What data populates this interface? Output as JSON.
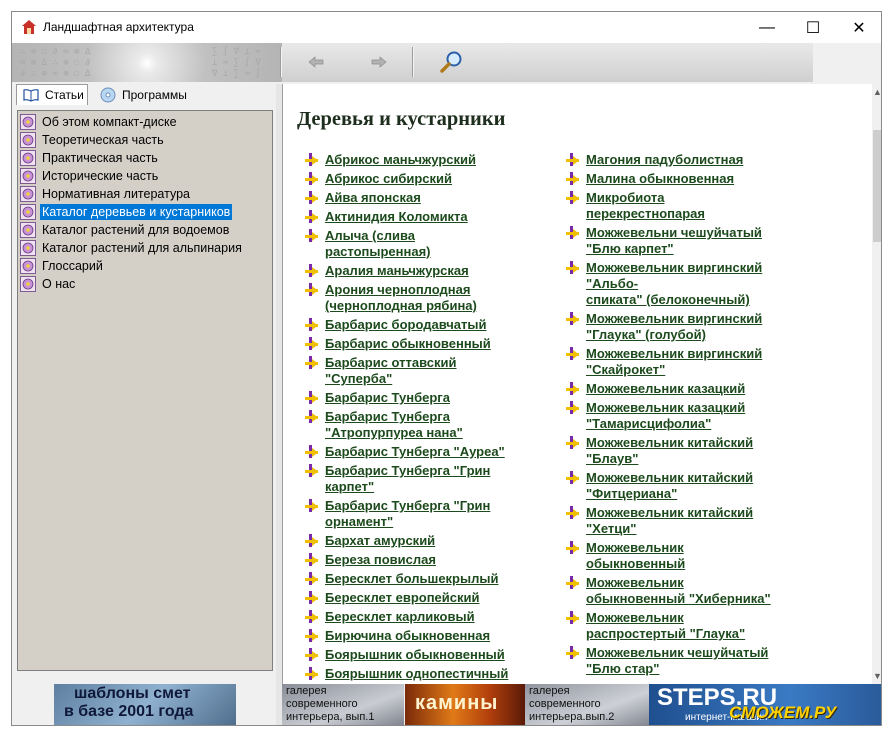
{
  "window": {
    "title": "Ландшафтная архитектура",
    "minimize": "—",
    "maximize": "☐",
    "close": "✕"
  },
  "toolbar": {
    "back_icon": "arrow-left-icon",
    "forward_icon": "arrow-right-icon",
    "search_icon": "magnifier-icon"
  },
  "tabs": [
    {
      "label": "Статьи",
      "icon": "book-icon",
      "active": true
    },
    {
      "label": "Программы",
      "icon": "cd-icon",
      "active": false
    }
  ],
  "tree": [
    {
      "label": "Об этом компакт-диске",
      "selected": false
    },
    {
      "label": "Теоретическая часть",
      "selected": false
    },
    {
      "label": "Практическая часть",
      "selected": false
    },
    {
      "label": "Исторические часть",
      "selected": false
    },
    {
      "label": "Нормативная литература",
      "selected": false
    },
    {
      "label": "Каталог деревьев и кустарников",
      "selected": true
    },
    {
      "label": "Каталог растений для водоемов",
      "selected": false
    },
    {
      "label": "Каталог растений для альпинария",
      "selected": false
    },
    {
      "label": "Глоссарий",
      "selected": false
    },
    {
      "label": "О нас",
      "selected": false
    }
  ],
  "content": {
    "heading": "Деревья и кустарники",
    "left_links": [
      [
        "Абрикос маньчжурский"
      ],
      [
        "Абрикос сибирский"
      ],
      [
        "Айва японская"
      ],
      [
        "Актинидия Коломикта"
      ],
      [
        "Алыча (слива",
        "растопыренная)"
      ],
      [
        "Аралия маньчжурская"
      ],
      [
        "Арония черноплодная",
        "(черноплодная рябина)"
      ],
      [
        "Барбарис бородавчатый"
      ],
      [
        "Барбарис обыкновенный"
      ],
      [
        "Барбарис оттавский",
        "\"Суперба\""
      ],
      [
        "Барбарис Тунберга"
      ],
      [
        "Барбарис Тунберга",
        "\"Атропурпуреа нана\""
      ],
      [
        "Барбарис Тунберга \"Ауреа\""
      ],
      [
        "Барбарис Тунберга \"Грин",
        "карпет\""
      ],
      [
        "Барбарис Тунберга \"Грин",
        "орнамент\""
      ],
      [
        "Бархат амурский"
      ],
      [
        "Береза повислая"
      ],
      [
        "Бересклет большекрылый"
      ],
      [
        "Бересклет европейский"
      ],
      [
        "Бересклет карликовый"
      ],
      [
        "Бирючина обыкновенная"
      ],
      [
        "Боярышник обыкновенный"
      ],
      [
        "Боярышник однопестичный"
      ]
    ],
    "right_links": [
      [
        "Магония падуболистная"
      ],
      [
        "Малина обыкновенная"
      ],
      [
        "Микробиота",
        "перекрестнопарая"
      ],
      [
        "Можжевельни чешуйчатый",
        "\"Блю карпет\""
      ],
      [
        "Можжевельник виргинский",
        "\"Альбо-",
        "спиката\" (белоконечный)"
      ],
      [
        "Можжевельник виргинский",
        "\"Глаука\" (голубой)"
      ],
      [
        "Можжевельник виргинский",
        "\"Скайрокет\""
      ],
      [
        "Можжевельник казацкий"
      ],
      [
        "Можжевельник казацкий",
        "\"Тамарисцифолиа\""
      ],
      [
        "Можжевельник китайский",
        "\"Блаув\""
      ],
      [
        "Можжевельник китайский",
        "\"Фитцериана\""
      ],
      [
        "Можжевельник китайский",
        "\"Хетци\""
      ],
      [
        "Можжевельник",
        "обыкновенный"
      ],
      [
        "Можжевельник",
        "обыкновенный \"Хиберника\""
      ],
      [
        "Можжевельник",
        "распростертый \"Глаука\""
      ],
      [
        "Можжевельник чешуйчатый",
        "\"Блю стар\""
      ]
    ]
  },
  "banners": {
    "smet_line1": "шаблоны смет",
    "smet_line2": "в базе 2001 года",
    "gallery1_line1": "галерея",
    "gallery1_line2": "современного",
    "gallery1_line3": "интерьера, вып.1",
    "kaminy": "камины",
    "gallery2_line1": "галерея",
    "gallery2_line2": "современного",
    "gallery2_line3": "интерьера.вып.2",
    "steps_title": "STEPS.RU",
    "steps_sub": "интернет-магазин",
    "watermark": "СМОЖЕМ.РУ"
  },
  "colors": {
    "link": "#1c4a1c",
    "heading": "#1e2e1e",
    "selection": "#0078d7",
    "bullet": "#f0c000",
    "bullet_marker": "#7a2aa8"
  }
}
